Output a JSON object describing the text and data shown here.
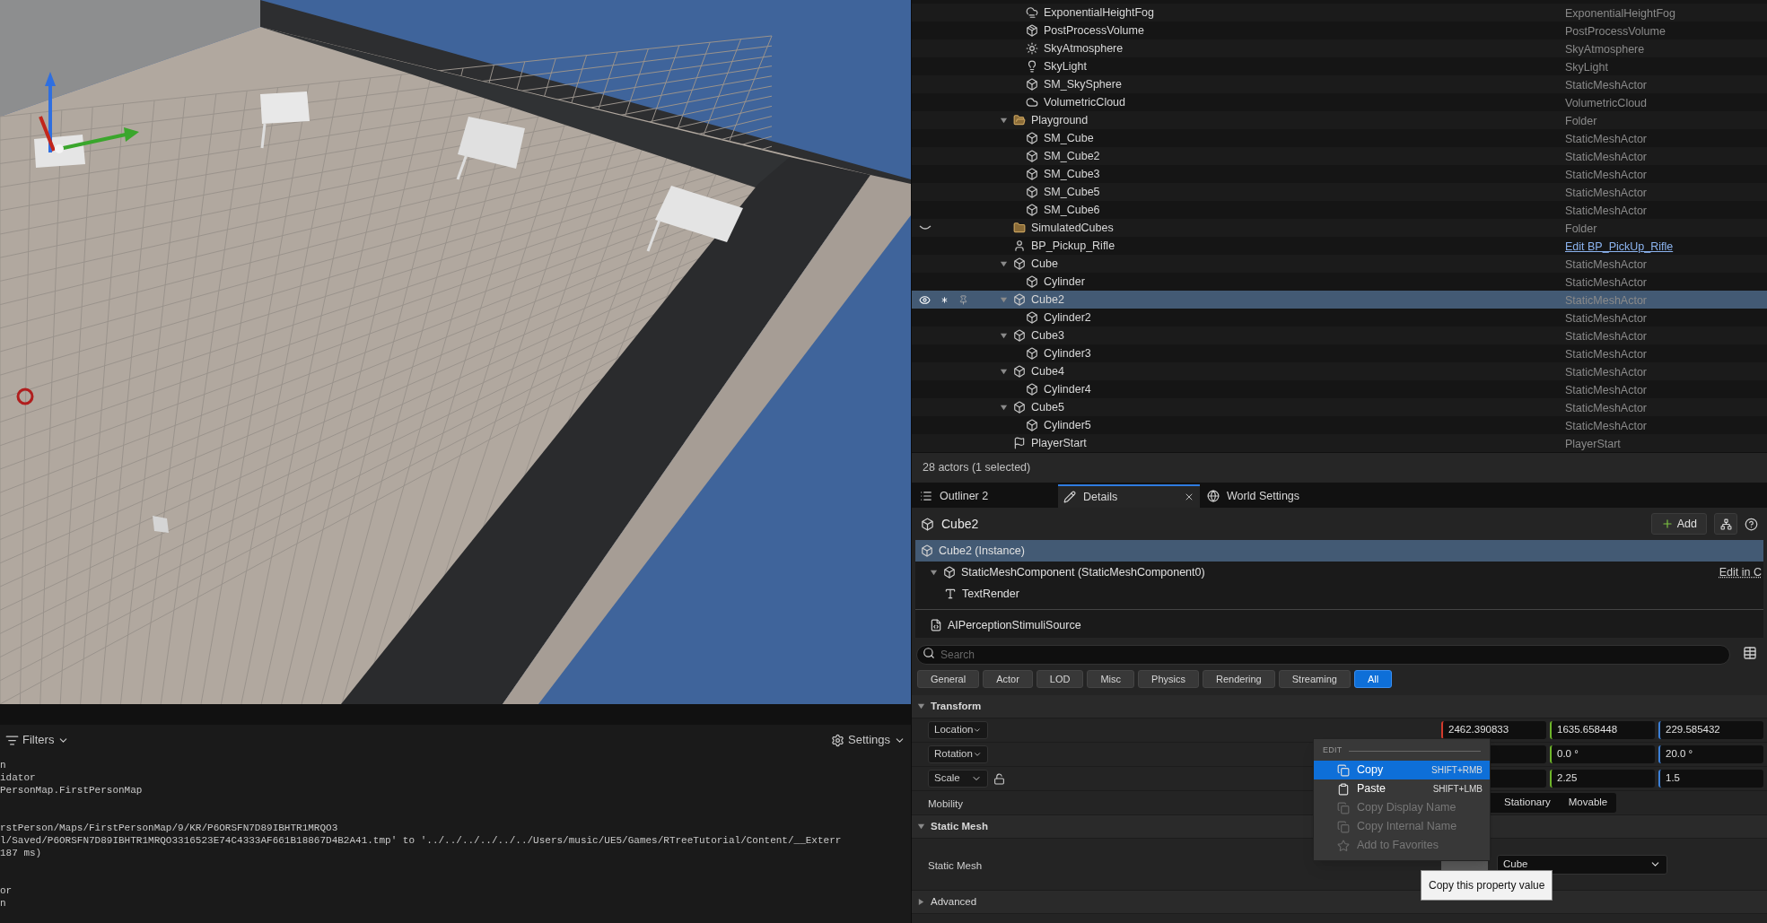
{
  "console": {
    "toolbar": {
      "filters": "Filters",
      "settings": "Settings"
    },
    "blocks": [
      [
        "n",
        "idator",
        "PersonMap.FirstPersonMap"
      ],
      [
        "rstPerson/Maps/FirstPersonMap/9/KR/P6ORSFN7D89IBHTR1MRQO3",
        "l/Saved/P6ORSFN7D89IBHTR1MRQO3316523E74C4333AF661B18867D4B2A41.tmp' to '../../../../../../Users/music/UE5/Games/RTreeTutorial/Content/__Exterr",
        "187 ms)"
      ],
      [
        "or",
        "n"
      ]
    ]
  },
  "outliner": {
    "continued_items": [
      {
        "label": "ExponentialHeightFog",
        "type": "ExponentialHeightFog",
        "kind": "fog",
        "selected": false,
        "hidden": false
      },
      {
        "label": "PostProcessVolume",
        "type": "PostProcessVolume",
        "kind": "volume",
        "selected": false,
        "hidden": false
      },
      {
        "label": "SkyAtmosphere",
        "type": "SkyAtmosphere",
        "kind": "sun",
        "selected": false,
        "hidden": false
      },
      {
        "label": "SkyLight",
        "type": "SkyLight",
        "kind": "light",
        "selected": false,
        "hidden": false
      },
      {
        "label": "SM_SkySphere",
        "type": "StaticMeshActor",
        "kind": "mesh",
        "selected": false,
        "hidden": false
      },
      {
        "label": "VolumetricCloud",
        "type": "VolumetricCloud",
        "kind": "cloud",
        "selected": false,
        "hidden": false
      }
    ],
    "items": [
      {
        "label": "Playground",
        "type": "Folder",
        "kind": "folder",
        "expanded": true,
        "selected": false,
        "hidden": false,
        "children": [
          {
            "label": "SM_Cube",
            "type": "StaticMeshActor",
            "kind": "mesh",
            "selected": false,
            "hidden": false
          },
          {
            "label": "SM_Cube2",
            "type": "StaticMeshActor",
            "kind": "mesh",
            "selected": false,
            "hidden": false
          },
          {
            "label": "SM_Cube3",
            "type": "StaticMeshActor",
            "kind": "mesh",
            "selected": false,
            "hidden": false
          },
          {
            "label": "SM_Cube5",
            "type": "StaticMeshActor",
            "kind": "mesh",
            "selected": false,
            "hidden": false
          },
          {
            "label": "SM_Cube6",
            "type": "StaticMeshActor",
            "kind": "mesh",
            "selected": false,
            "hidden": false
          }
        ]
      },
      {
        "label": "SimulatedCubes",
        "type": "Folder",
        "kind": "folder",
        "selected": false,
        "hidden": true
      },
      {
        "label": "BP_Pickup_Rifle",
        "type": "Edit BP_PickUp_Rifle",
        "type_link": true,
        "kind": "pawn",
        "selected": false,
        "hidden": false
      },
      {
        "label": "Cube",
        "type": "StaticMeshActor",
        "kind": "mesh",
        "expanded": true,
        "selected": false,
        "hidden": false,
        "children": [
          {
            "label": "Cylinder",
            "type": "StaticMeshActor",
            "kind": "mesh",
            "selected": false,
            "hidden": false
          }
        ]
      },
      {
        "label": "Cube2",
        "type": "StaticMeshActor",
        "kind": "mesh",
        "expanded": true,
        "selected": true,
        "hidden": false,
        "children": [
          {
            "label": "Cylinder2",
            "type": "StaticMeshActor",
            "kind": "mesh",
            "selected": false,
            "hidden": false
          }
        ]
      },
      {
        "label": "Cube3",
        "type": "StaticMeshActor",
        "kind": "mesh",
        "expanded": true,
        "selected": false,
        "hidden": false,
        "children": [
          {
            "label": "Cylinder3",
            "type": "StaticMeshActor",
            "kind": "mesh",
            "selected": false,
            "hidden": false
          }
        ]
      },
      {
        "label": "Cube4",
        "type": "StaticMeshActor",
        "kind": "mesh",
        "expanded": true,
        "selected": false,
        "hidden": false,
        "children": [
          {
            "label": "Cylinder4",
            "type": "StaticMeshActor",
            "kind": "mesh",
            "selected": false,
            "hidden": false
          }
        ]
      },
      {
        "label": "Cube5",
        "type": "StaticMeshActor",
        "kind": "mesh",
        "expanded": true,
        "selected": false,
        "hidden": false,
        "children": [
          {
            "label": "Cylinder5",
            "type": "StaticMeshActor",
            "kind": "mesh",
            "selected": false,
            "hidden": false
          }
        ]
      },
      {
        "label": "PlayerStart",
        "type": "PlayerStart",
        "kind": "start",
        "selected": false,
        "hidden": false
      }
    ],
    "status": "28 actors (1 selected)"
  },
  "tabs": [
    {
      "label": "Outliner 2",
      "kind": "list",
      "selected": false,
      "closable": false
    },
    {
      "label": "Details",
      "kind": "pencil",
      "selected": true,
      "closable": true
    },
    {
      "label": "World Settings",
      "kind": "globe",
      "selected": false,
      "closable": false
    }
  ],
  "details": {
    "title": "Cube2",
    "add_button": "Add",
    "components": [
      {
        "label": "Cube2 (Instance)",
        "kind": "mesh",
        "selected": true
      },
      {
        "label": "StaticMeshComponent (StaticMeshComponent0)",
        "kind": "mesh",
        "expanded": true,
        "action": "Edit in C",
        "selected": false,
        "children": [
          {
            "label": "TextRender",
            "kind": "text",
            "selected": false
          }
        ]
      },
      {
        "label": "AIPerceptionStimuliSource",
        "kind": "class",
        "selected": false,
        "separated": true
      }
    ],
    "search": {
      "placeholder": "Search"
    },
    "categories": [
      {
        "label": "General",
        "selected": false
      },
      {
        "label": "Actor",
        "selected": false
      },
      {
        "label": "LOD",
        "selected": false
      },
      {
        "label": "Misc",
        "selected": false
      },
      {
        "label": "Physics",
        "selected": false
      },
      {
        "label": "Rendering",
        "selected": false
      },
      {
        "label": "Streaming",
        "selected": false
      },
      {
        "label": "All",
        "selected": true
      }
    ],
    "sections": [
      {
        "title": "Transform",
        "expanded": true,
        "rows": [
          {
            "kind": "vector",
            "label": "Location",
            "values": [
              "2462.390833",
              "1635.658448",
              "229.585432"
            ]
          },
          {
            "kind": "vector",
            "label": "Rotation",
            "values": [
              "0.0 °",
              "20.0 °"
            ]
          },
          {
            "kind": "vector",
            "label": "Scale",
            "locked": false,
            "values": [
              "2.25",
              "1.5"
            ]
          },
          {
            "kind": "choice",
            "label": "Mobility",
            "options": [
              {
                "label": "Stationary",
                "selected": false
              },
              {
                "label": "Movable",
                "selected": false
              }
            ]
          }
        ]
      },
      {
        "title": "Static Mesh",
        "expanded": true,
        "rows": [
          {
            "kind": "asset",
            "label": "Static Mesh",
            "value": "Cube"
          }
        ]
      },
      {
        "title": "Advanced",
        "expanded": false
      }
    ]
  },
  "context_menu": {
    "heading": "EDIT",
    "items": [
      {
        "label": "Copy",
        "shortcut": "SHIFT+RMB",
        "kind": "copy",
        "selected": true,
        "disabled": false
      },
      {
        "label": "Paste",
        "shortcut": "SHIFT+LMB",
        "kind": "paste",
        "selected": false,
        "disabled": false
      },
      {
        "label": "Copy Display Name",
        "kind": "copy",
        "selected": false,
        "disabled": true
      },
      {
        "label": "Copy Internal Name",
        "kind": "copy",
        "selected": false,
        "disabled": true
      },
      {
        "label": "Add to Favorites",
        "kind": "star",
        "selected": false,
        "disabled": true
      }
    ]
  },
  "tooltip": "Copy this property value"
}
